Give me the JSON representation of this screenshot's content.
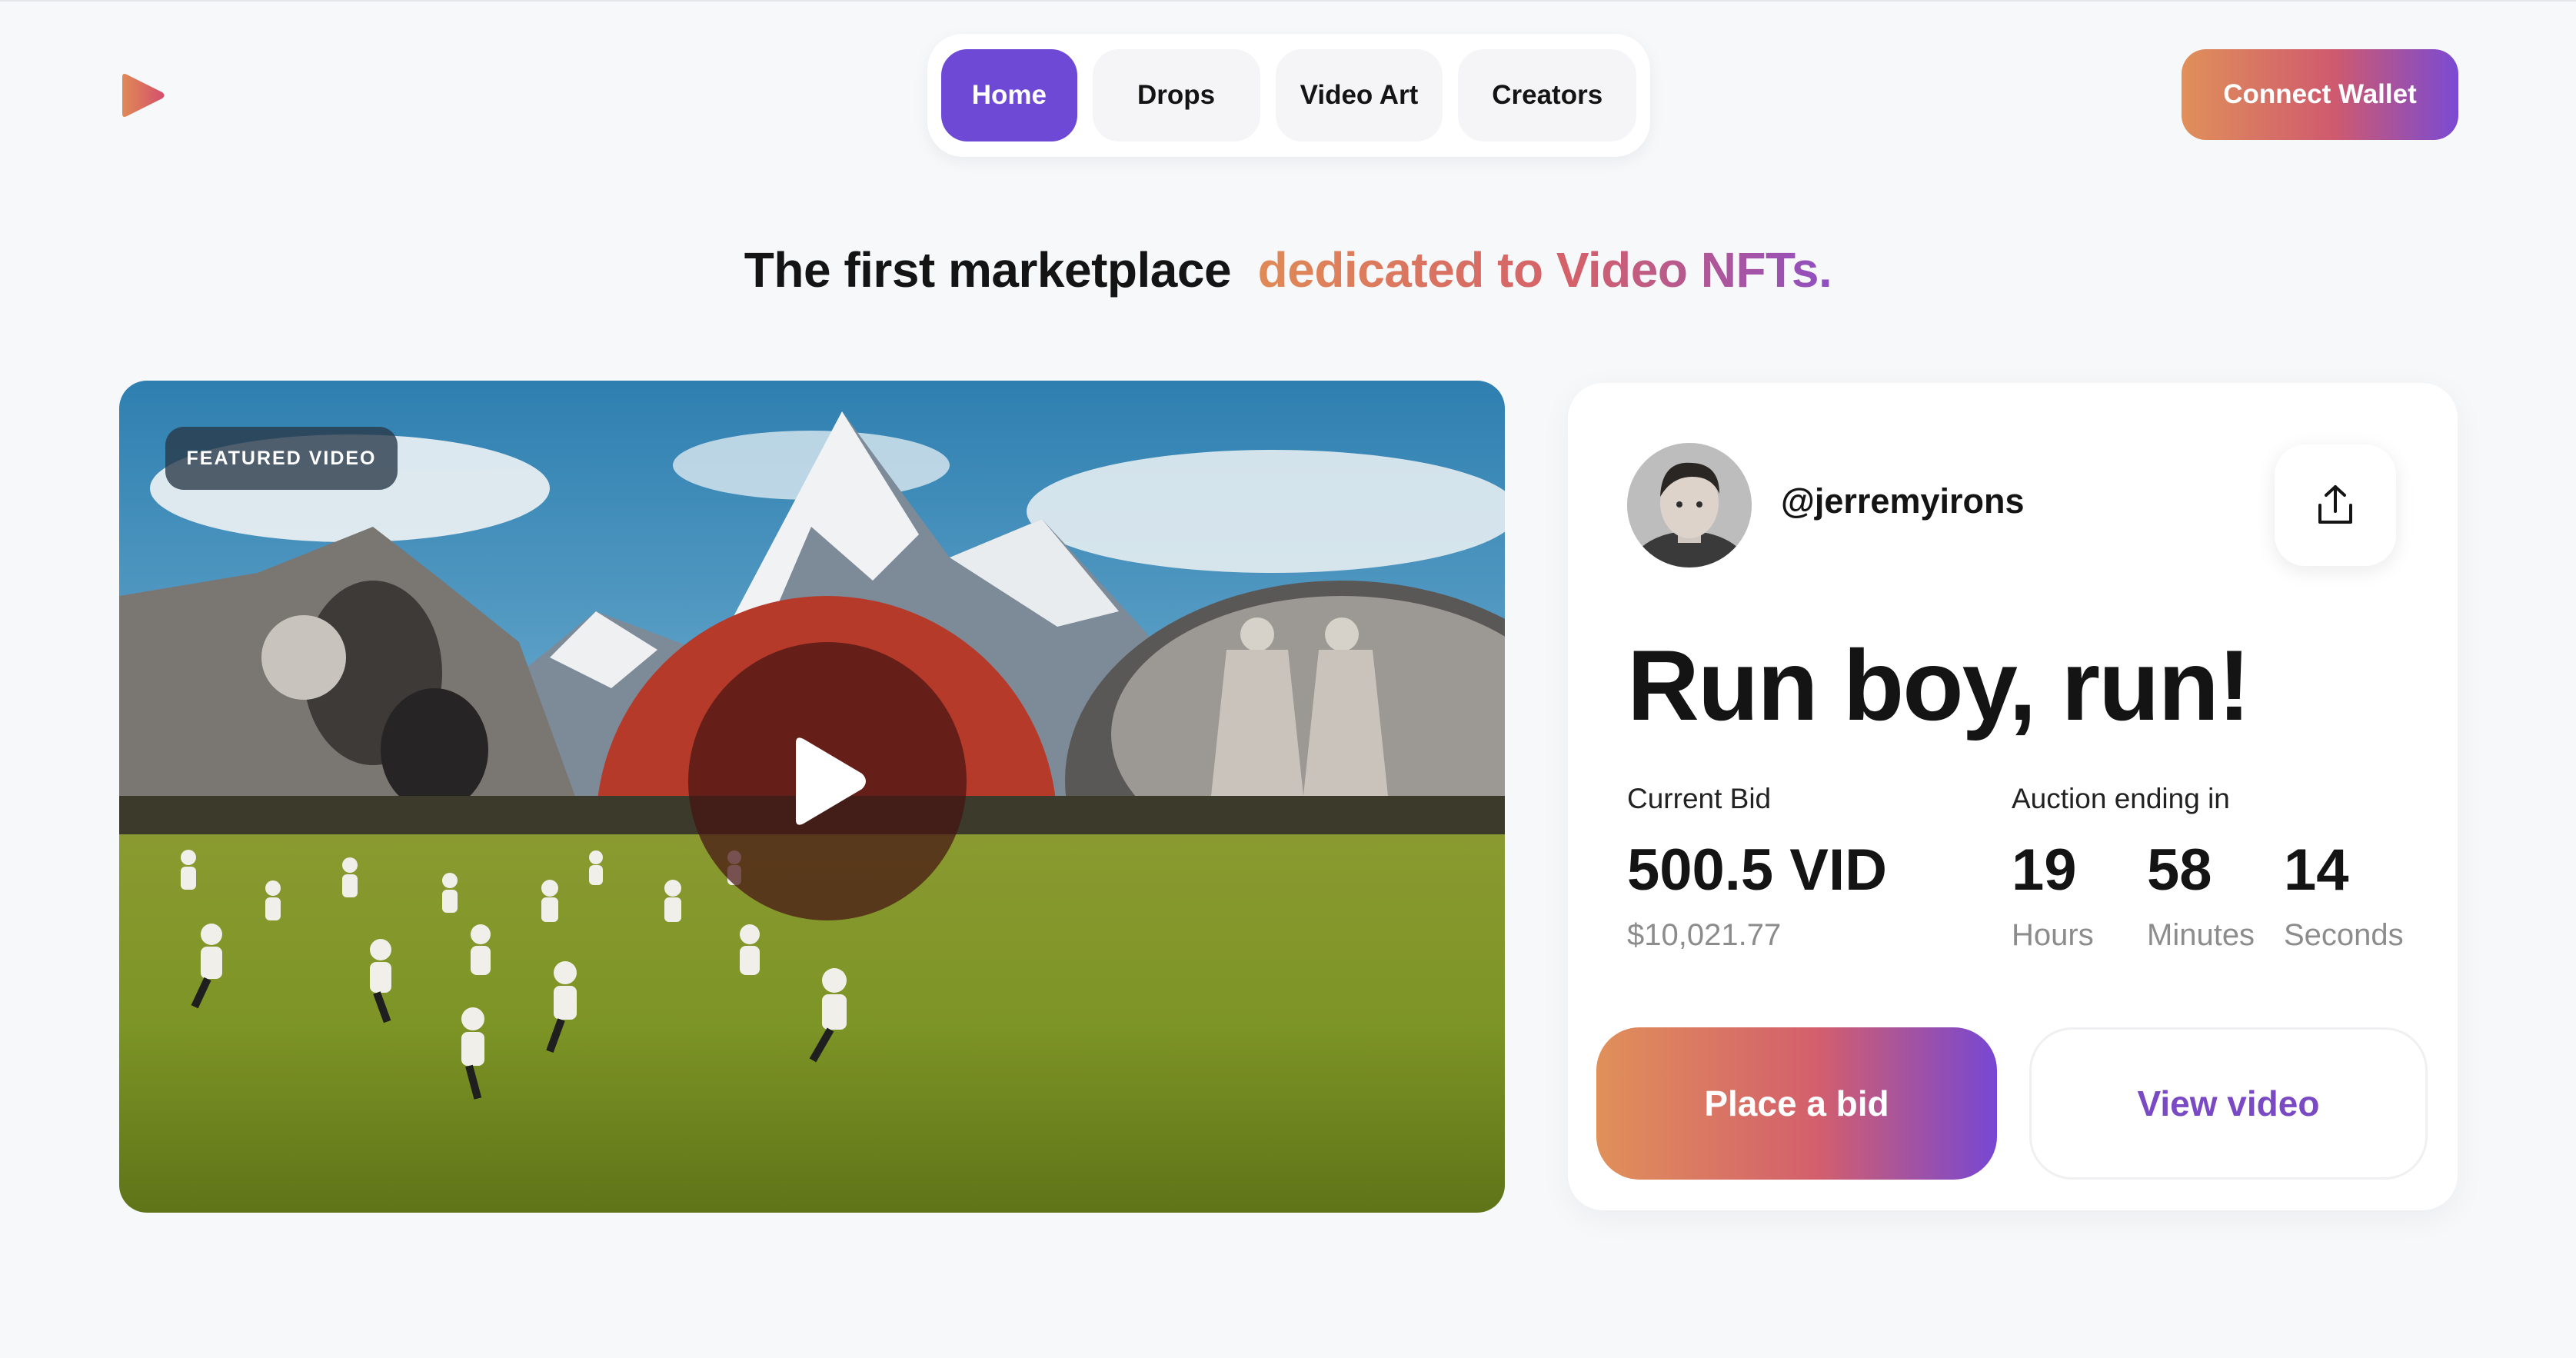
{
  "header": {
    "logo_icon": "play-triangle-logo",
    "nav": [
      {
        "label": "Home",
        "active": true
      },
      {
        "label": "Drops",
        "active": false
      },
      {
        "label": "Video Art",
        "active": false
      },
      {
        "label": "Creators",
        "active": false
      }
    ],
    "connect_label": "Connect Wallet"
  },
  "hero": {
    "headline_plain": "The first marketplace",
    "headline_accent": "dedicated to Video NFTs."
  },
  "featured": {
    "badge": "FEATURED VIDEO",
    "play_icon": "play-icon"
  },
  "card": {
    "username": "@jerremyirons",
    "share_icon": "share-icon",
    "title": "Run boy, run!",
    "current_bid_label": "Current Bid",
    "current_bid": "500.5 VID",
    "current_bid_usd": "$10,021.77",
    "auction_label": "Auction ending in",
    "timer": [
      {
        "value": "19",
        "unit": "Hours"
      },
      {
        "value": "58",
        "unit": "Minutes"
      },
      {
        "value": "14",
        "unit": "Seconds"
      }
    ],
    "place_bid_label": "Place a bid",
    "view_video_label": "View video"
  },
  "colors": {
    "accent_purple": "#6d49d6",
    "gradient_start": "#e0905a",
    "gradient_mid": "#d35f6c",
    "gradient_end": "#7747d3"
  }
}
